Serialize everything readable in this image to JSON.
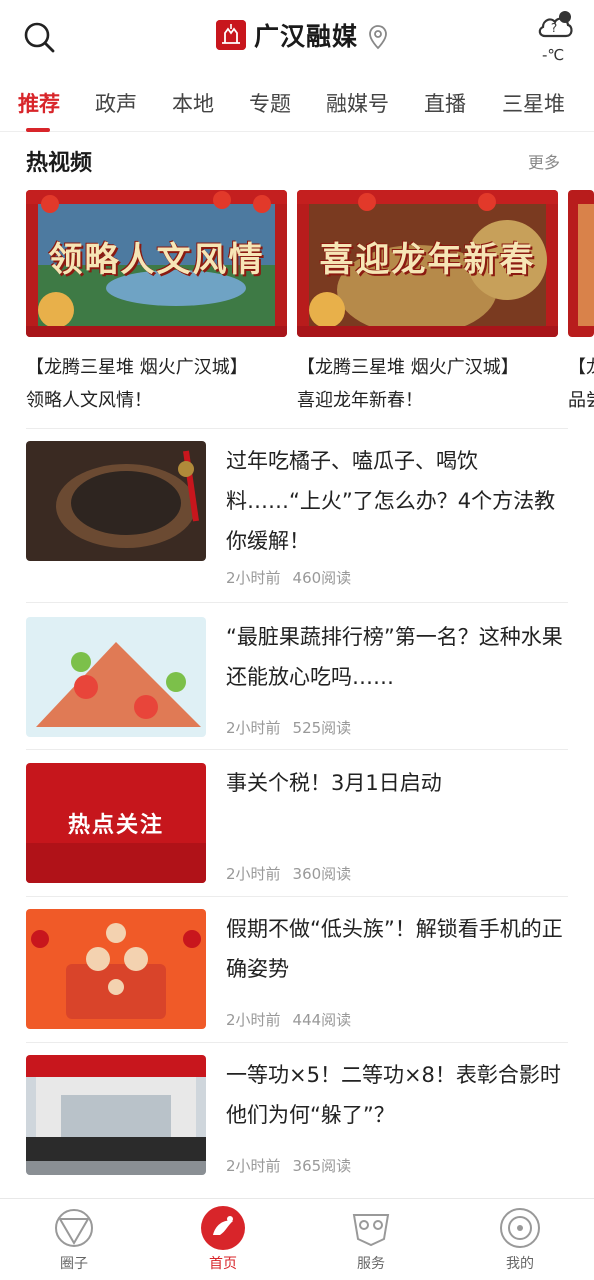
{
  "header": {
    "logo_text": "广汉融媒",
    "weather_temp": "-℃"
  },
  "tabs": [
    {
      "label": "推荐",
      "active": true
    },
    {
      "label": "政声"
    },
    {
      "label": "本地"
    },
    {
      "label": "专题"
    },
    {
      "label": "融媒号"
    },
    {
      "label": "直播"
    },
    {
      "label": "三星堆"
    }
  ],
  "hot_video": {
    "title": "热视频",
    "more": "更多",
    "items": [
      {
        "thumb_text": "领略人文风情",
        "line1": "【龙腾三星堆 烟火广汉城】",
        "line2": "领略人文风情！"
      },
      {
        "thumb_text": "喜迎龙年新春",
        "line1": "【龙腾三星堆 烟火广汉城】",
        "line2": "喜迎龙年新春！"
      },
      {
        "thumb_text": "",
        "line1": "【龙",
        "line2": "品尝"
      }
    ]
  },
  "news": [
    {
      "title": "过年吃橘子、嗑瓜子、喝饮料……“上火”了怎么办？4个方法教你缓解！",
      "time": "2小时前",
      "reads": "460阅读"
    },
    {
      "title": "“最脏果蔬排行榜”第一名？这种水果还能放心吃吗……",
      "time": "2小时前",
      "reads": "525阅读"
    },
    {
      "title": "事关个税！3月1日启动",
      "time": "2小时前",
      "reads": "360阅读",
      "thumb_text": "热点关注"
    },
    {
      "title": "假期不做“低头族”！解锁看手机的正确姿势",
      "time": "2小时前",
      "reads": "444阅读"
    },
    {
      "title": "一等功×5！二等功×8！表彰合影时他们为何“躲了”？",
      "time": "2小时前",
      "reads": "365阅读"
    }
  ],
  "bottom_nav": [
    {
      "label": "圈子",
      "icon": "circle-community-icon"
    },
    {
      "label": "首页",
      "icon": "home-icon",
      "active": true
    },
    {
      "label": "服务",
      "icon": "mask-service-icon"
    },
    {
      "label": "我的",
      "icon": "profile-icon"
    }
  ],
  "colors": {
    "accent": "#d8252a"
  }
}
